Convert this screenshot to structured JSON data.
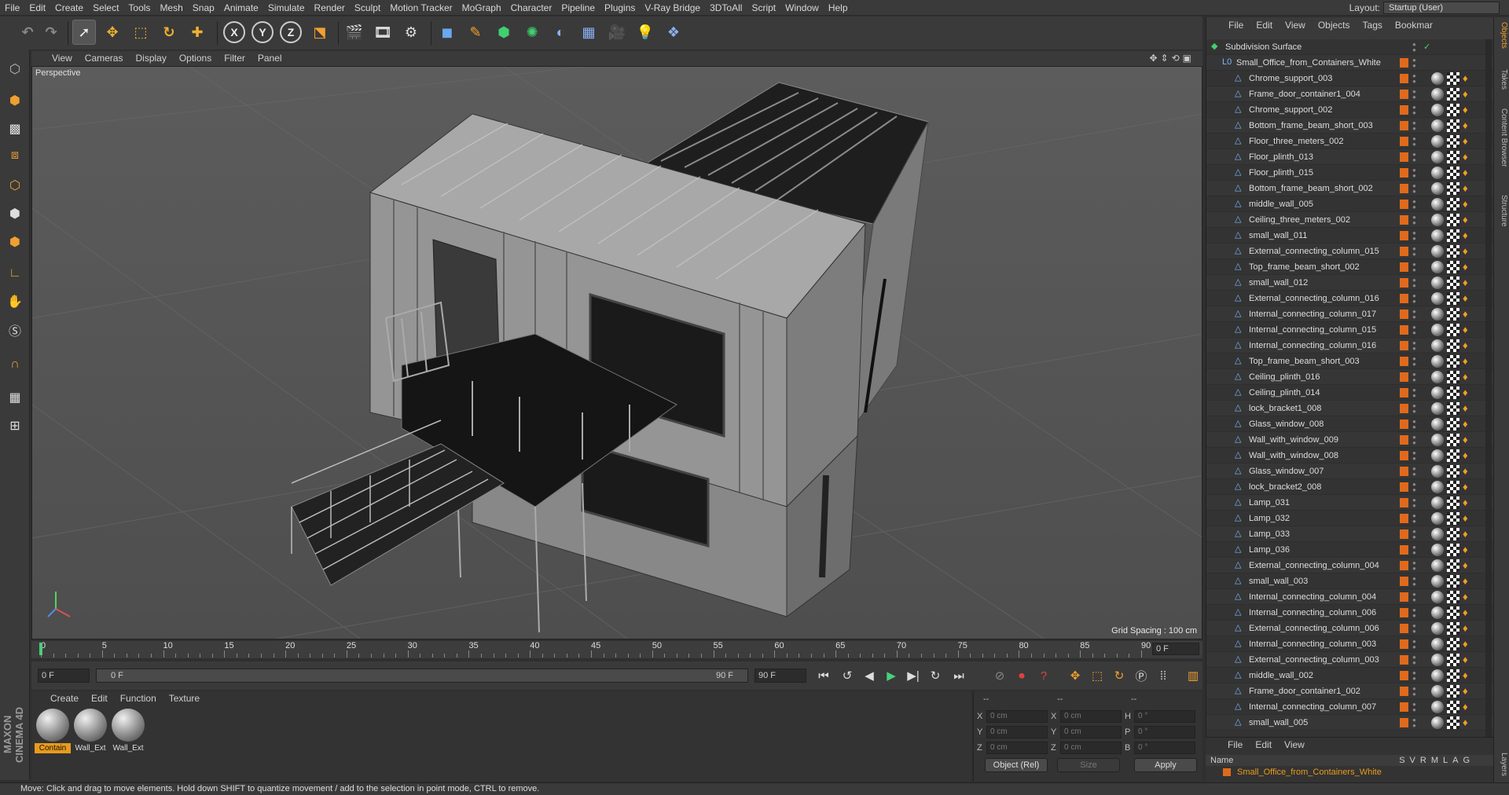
{
  "menubar": {
    "items": [
      "File",
      "Edit",
      "Create",
      "Select",
      "Tools",
      "Mesh",
      "Snap",
      "Animate",
      "Simulate",
      "Render",
      "Sculpt",
      "Motion Tracker",
      "MoGraph",
      "Character",
      "Pipeline",
      "Plugins",
      "V-Ray Bridge",
      "3DToAll",
      "Script",
      "Window",
      "Help"
    ],
    "layout_label": "Layout:",
    "layout_value": "Startup (User)"
  },
  "viewport": {
    "menu": [
      "View",
      "Cameras",
      "Display",
      "Options",
      "Filter",
      "Panel"
    ],
    "camera_label": "Perspective",
    "grid_spacing": "Grid Spacing : 100 cm"
  },
  "timeline": {
    "ticks": [
      "0",
      "5",
      "10",
      "15",
      "20",
      "25",
      "30",
      "35",
      "40",
      "45",
      "50",
      "55",
      "60",
      "65",
      "70",
      "75",
      "80",
      "85",
      "90"
    ],
    "current_frame": "0 F"
  },
  "transport": {
    "start_field": "0 F",
    "range_start": "0 F",
    "range_end": "90 F",
    "end_field": "90 F"
  },
  "materials": {
    "menu": [
      "Create",
      "Edit",
      "Function",
      "Texture"
    ],
    "items": [
      {
        "label": "Contain",
        "active": true
      },
      {
        "label": "Wall_Ext",
        "active": false
      },
      {
        "label": "Wall_Ext",
        "active": false
      }
    ]
  },
  "coordinates": {
    "header": [
      "--",
      "--",
      "--"
    ],
    "rows": [
      {
        "a": "X",
        "av": "0 cm",
        "b": "X",
        "bv": "0 cm",
        "c": "H",
        "cv": "0 °"
      },
      {
        "a": "Y",
        "av": "0 cm",
        "b": "Y",
        "bv": "0 cm",
        "c": "P",
        "cv": "0 °"
      },
      {
        "a": "Z",
        "av": "0 cm",
        "b": "Z",
        "bv": "0 cm",
        "c": "B",
        "cv": "0 °"
      }
    ],
    "mode_select": "Object (Rel)",
    "size_select": "Size",
    "apply_label": "Apply"
  },
  "status": "Move: Click and drag to move elements. Hold down SHIFT to quantize movement / add to the selection in point mode, CTRL to remove.",
  "object_manager": {
    "menu": [
      "File",
      "Edit",
      "View",
      "Objects",
      "Tags",
      "Bookmar"
    ],
    "root": "Subdivision Surface",
    "group": "Small_Office_from_Containers_White",
    "objects": [
      "Chrome_support_003",
      "Frame_door_container1_004",
      "Chrome_support_002",
      "Bottom_frame_beam_short_003",
      "Floor_three_meters_002",
      "Floor_plinth_013",
      "Floor_plinth_015",
      "Bottom_frame_beam_short_002",
      "middle_wall_005",
      "Ceiling_three_meters_002",
      "small_wall_011",
      "External_connecting_column_015",
      "Top_frame_beam_short_002",
      "small_wall_012",
      "External_connecting_column_016",
      "Internal_connecting_column_017",
      "Internal_connecting_column_015",
      "Internal_connecting_column_016",
      "Top_frame_beam_short_003",
      "Ceiling_plinth_016",
      "Ceiling_plinth_014",
      "lock_bracket1_008",
      "Glass_window_008",
      "Wall_with_window_009",
      "Wall_with_window_008",
      "Glass_window_007",
      "lock_bracket2_008",
      "Lamp_031",
      "Lamp_032",
      "Lamp_033",
      "Lamp_036",
      "External_connecting_column_004",
      "small_wall_003",
      "Internal_connecting_column_004",
      "Internal_connecting_column_006",
      "External_connecting_column_006",
      "Internal_connecting_column_003",
      "External_connecting_column_003",
      "middle_wall_002",
      "Frame_door_container1_002",
      "Internal_connecting_column_007",
      "small_wall_005"
    ]
  },
  "side_tabs": [
    "Objects",
    "Takes",
    "Content Browser",
    "Structure",
    "Layers"
  ],
  "layers": {
    "menu": [
      "File",
      "Edit",
      "View"
    ],
    "columns": "Name",
    "flags": [
      "S",
      "V",
      "R",
      "M",
      "L",
      "A",
      "G"
    ],
    "row": "Small_Office_from_Containers_White"
  },
  "brand": "MAXON CINEMA 4D",
  "colors": {
    "accent": "#e89b1c",
    "object_tag": "#e06a1c",
    "icon_blue": "#7fb4ff"
  }
}
